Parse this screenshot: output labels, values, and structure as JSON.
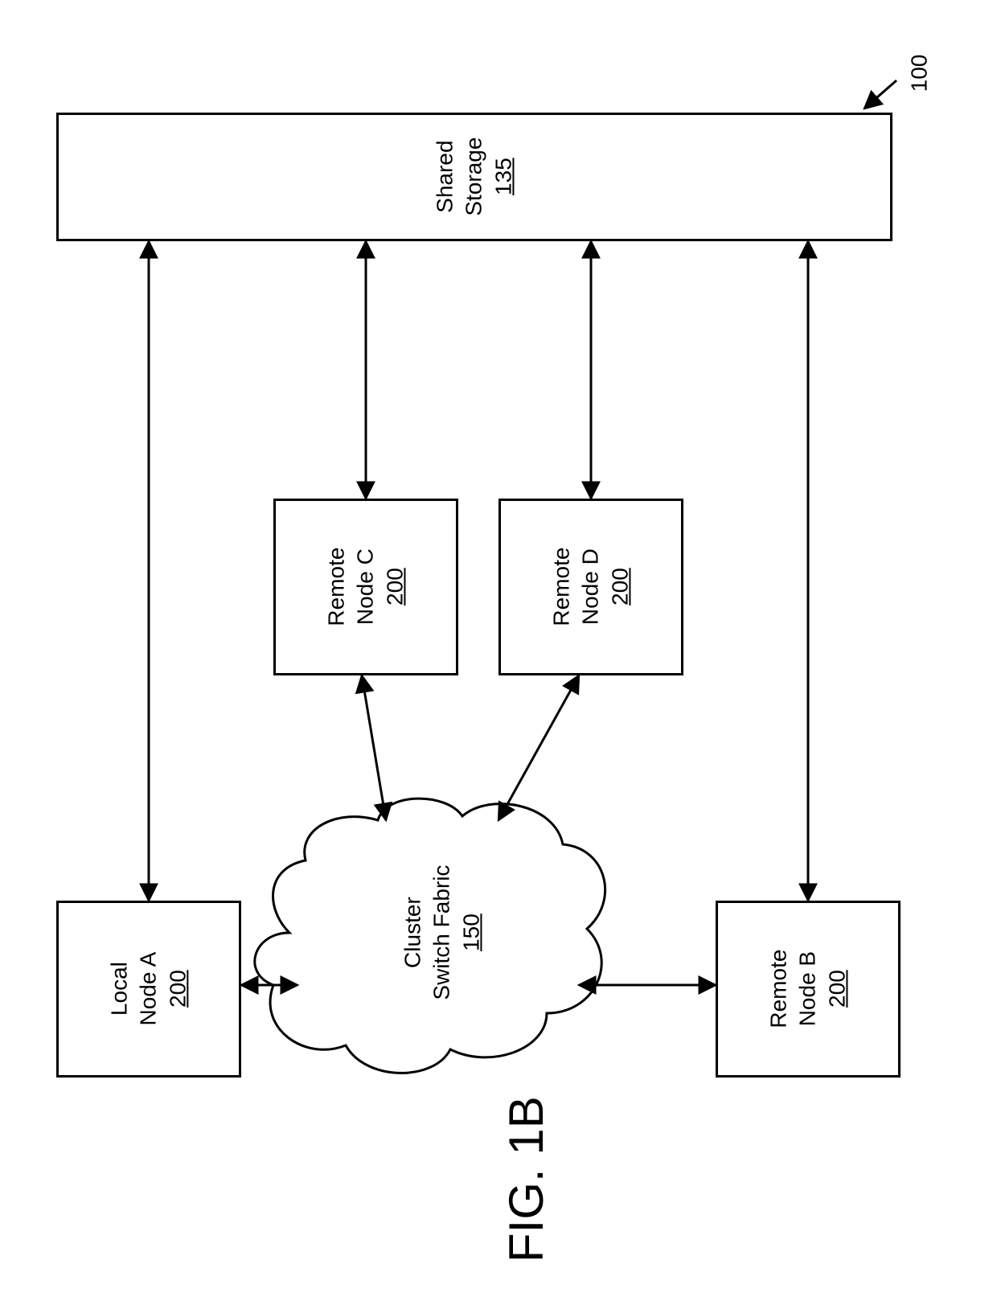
{
  "figure": {
    "caption": "FIG. 1B",
    "reference_number": "100"
  },
  "nodes": {
    "nodeA": {
      "line1": "Local",
      "line2": "Node A",
      "num": "200"
    },
    "nodeB": {
      "line1": "Remote",
      "line2": "Node B",
      "num": "200"
    },
    "nodeC": {
      "line1": "Remote",
      "line2": "Node C",
      "num": "200"
    },
    "nodeD": {
      "line1": "Remote",
      "line2": "Node D",
      "num": "200"
    },
    "fabric": {
      "line1": "Cluster",
      "line2": "Switch Fabric",
      "num": "150"
    },
    "storage": {
      "line1": "Shared",
      "line2": "Storage",
      "num": "135"
    }
  }
}
